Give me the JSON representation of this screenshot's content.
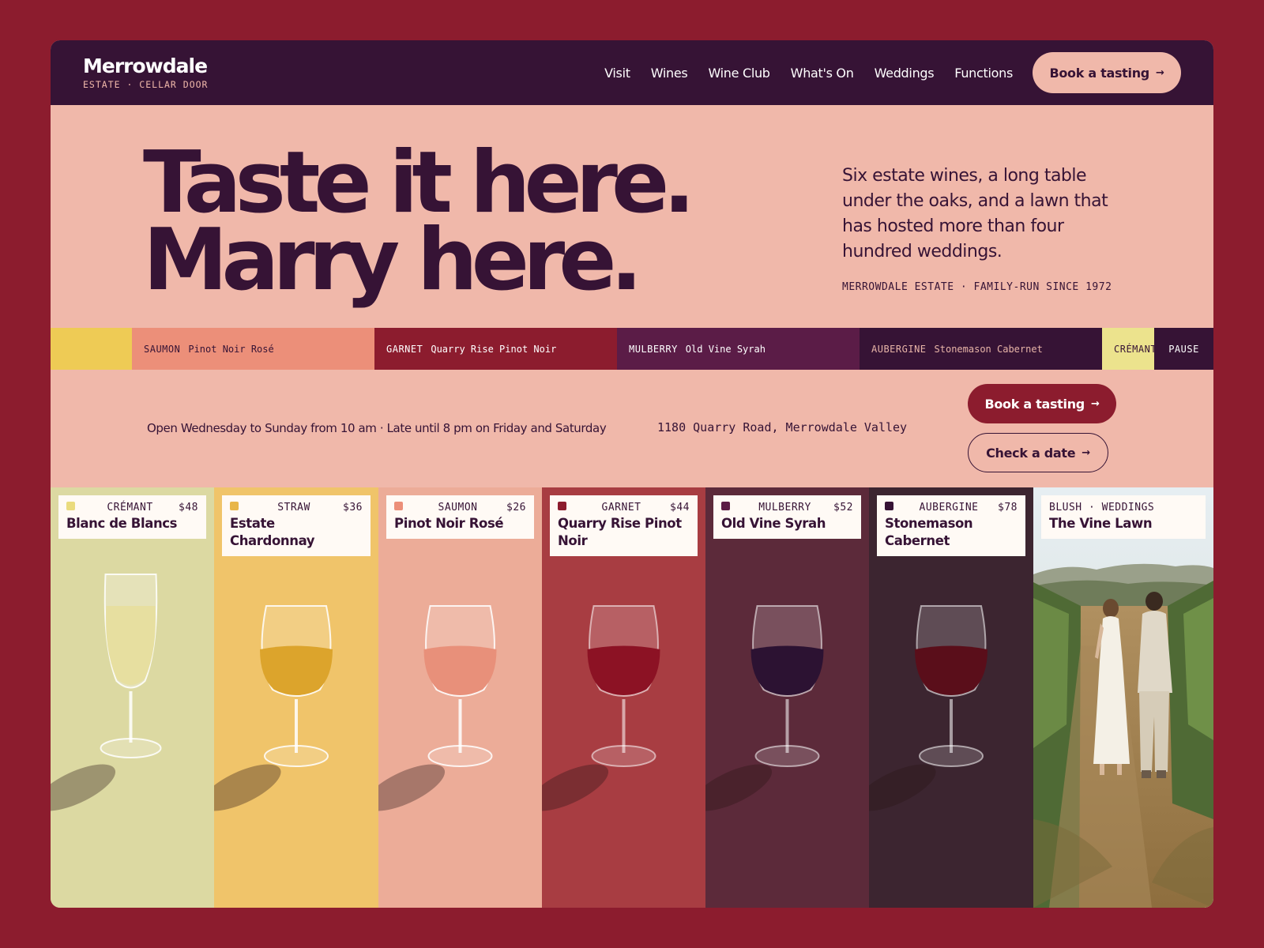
{
  "brand": {
    "name": "Merrowdale",
    "subtitle": "ESTATE · CELLAR DOOR"
  },
  "nav": {
    "links": [
      "Visit",
      "Wines",
      "Wine Club",
      "What's On",
      "Weddings",
      "Functions"
    ],
    "cta": "Book a tasting"
  },
  "hero": {
    "title_line1": "Taste it here.",
    "title_line2": "Marry here.",
    "description": "Six estate wines, a long table under the oaks, and a lawn that has hosted more than four hundred weddings.",
    "meta": "MERROWDALE ESTATE · FAMILY-RUN SINCE 1972"
  },
  "band": {
    "segments": [
      {
        "tag": "",
        "label": "",
        "color": "#eecb55",
        "text_color": "#361335"
      },
      {
        "tag": "SAUMON",
        "label": "Pinot Noir Rosé",
        "color": "#ec8f79",
        "text_color": "#361335"
      },
      {
        "tag": "GARNET",
        "label": "Quarry Rise Pinot Noir",
        "color": "#8c1c2e",
        "text_color": "#ffffff"
      },
      {
        "tag": "MULBERRY",
        "label": "Old Vine Syrah",
        "color": "#5b1c47",
        "text_color": "#ffffff"
      },
      {
        "tag": "AUBERGINE",
        "label": "Stonemason Cabernet",
        "color": "#361335",
        "text_color": "#e8b5a8"
      },
      {
        "tag": "CRÉMANT",
        "label": "",
        "color": "#ece38d",
        "text_color": "#361335"
      }
    ],
    "pause": "PAUSE"
  },
  "info": {
    "hours": "Open Wednesday to Sunday from 10 am · Late until 8 pm on Friday and Saturday",
    "address": "1180 Quarry Road, Merrowdale Valley",
    "book": "Book a tasting",
    "check": "Check a date",
    "arrow": "→"
  },
  "cards": [
    {
      "tag": "CRÉMANT",
      "price": "$48",
      "name": "Blanc de Blancs",
      "swatch": "#eadb7e",
      "bg": "#dcd9a2",
      "wine": "#e7dfa0"
    },
    {
      "tag": "STRAW",
      "price": "$36",
      "name": "Estate Chardonnay",
      "swatch": "#e8b64a",
      "bg": "#f0c46a",
      "wine": "#dca42c"
    },
    {
      "tag": "SAUMON",
      "price": "$26",
      "name": "Pinot Noir Rosé",
      "swatch": "#ec8f79",
      "bg": "#ecac98",
      "wine": "#e8907a"
    },
    {
      "tag": "GARNET",
      "price": "$44",
      "name": "Quarry Rise Pinot Noir",
      "swatch": "#8c1c2e",
      "bg": "#a83d42",
      "wine": "#8c1224"
    },
    {
      "tag": "MULBERRY",
      "price": "$52",
      "name": "Old Vine Syrah",
      "swatch": "#5b1c47",
      "bg": "#5c2a3a",
      "wine": "#2c1232"
    },
    {
      "tag": "AUBERGINE",
      "price": "$78",
      "name": "Stonemason Cabernet",
      "swatch": "#361335",
      "bg": "#3c2530",
      "wine": "#5a0e1a"
    },
    {
      "tag": "BLUSH · WEDDINGS",
      "price": "",
      "name": "The Vine Lawn",
      "swatch": "",
      "bg": "#b79a6a",
      "wine": ""
    }
  ]
}
